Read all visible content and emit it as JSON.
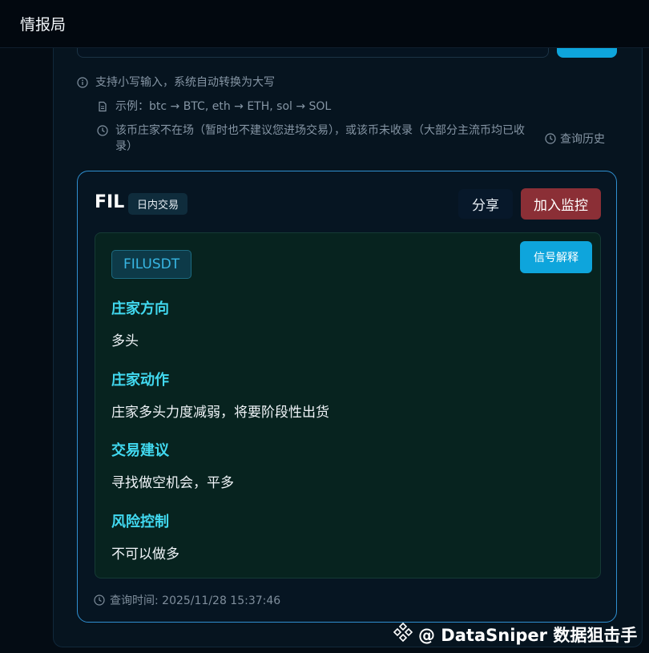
{
  "app": {
    "title": "情报局"
  },
  "hints": [
    {
      "icon": "info-icon",
      "text": "支持小写输入，系统自动转换为大写"
    },
    {
      "icon": "document-icon",
      "text": "示例：btc → BTC, eth → ETH, sol → SOL"
    },
    {
      "icon": "clock-icon",
      "text": "该币庄家不在场（暂时也不建议您进场交易），或该币未收录（大部分主流币均已收录）"
    }
  ],
  "history": {
    "label": "查询历史"
  },
  "result": {
    "symbol": "FIL",
    "mode": "日内交易",
    "share_label": "分享",
    "monitor_label": "加入监控",
    "pair": "FILUSDT",
    "explain_label": "信号解释",
    "sections": [
      {
        "title": "庄家方向",
        "value": "多头"
      },
      {
        "title": "庄家动作",
        "value": "庄家多头力度减弱，将要阶段性出货"
      },
      {
        "title": "交易建议",
        "value": "寻找做空机会，平多"
      },
      {
        "title": "风险控制",
        "value": "不可以做多"
      }
    ],
    "query_time_label": "查询时间: 2025/11/28 15:37:46"
  },
  "watermark": {
    "text": "@ DataSniper 数据狙击手"
  },
  "colors": {
    "accent": "#0ea5dc",
    "danger": "#8b2f36",
    "section_title": "#41d9f0",
    "card_border": "#2f8fd0"
  }
}
